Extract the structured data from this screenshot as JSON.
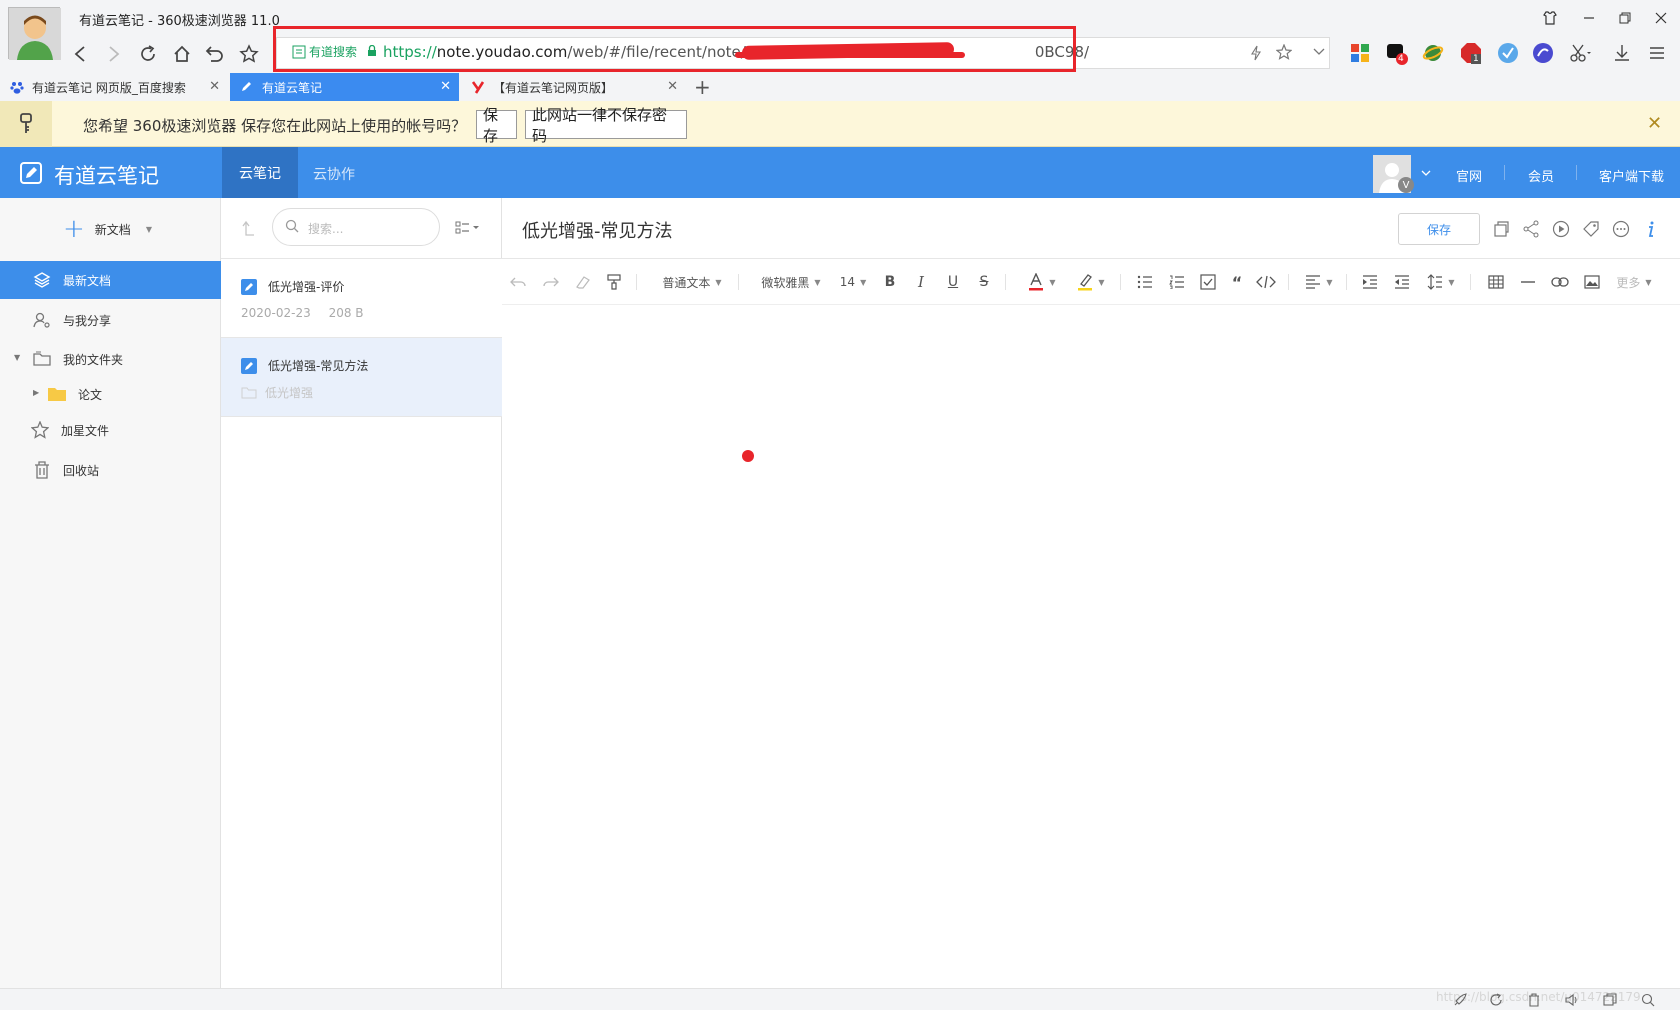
{
  "browser": {
    "window_title": "有道云笔记 - 360极速浏览器 11.0",
    "search_engine": "有道搜索",
    "url_proto": "https://",
    "url_host": "note.youdao.com",
    "url_path": "/web/#/file/recent/note/06CE",
    "url_tail": "0BC98/",
    "ext_badge_1": "4",
    "ext_badge_2": "1",
    "tabs": [
      {
        "label": "有道云笔记 网页版_百度搜索"
      },
      {
        "label": "有道云笔记"
      },
      {
        "label": "【有道云笔记网页版】"
      }
    ],
    "accent": "#3b8bf0",
    "highlight_color": "#e8252b"
  },
  "password_bar": {
    "text": "您希望 360极速浏览器 保存您在此网站上使用的帐号吗？",
    "save": "保存",
    "never": "此网站一律不保存密码"
  },
  "app": {
    "logo_text": "有道云笔记",
    "nav_notes": "云笔记",
    "nav_collab": "云协作",
    "links": [
      "官网",
      "会员",
      "客户端下载"
    ],
    "avatar_badge": "V",
    "brand_color": "#3d8eea"
  },
  "sidebar": {
    "new_doc": "新文档",
    "items": [
      {
        "label": "最新文档"
      },
      {
        "label": "与我分享"
      },
      {
        "label": "我的文件夹"
      },
      {
        "label": "论文"
      },
      {
        "label": "加星文件"
      },
      {
        "label": "回收站"
      }
    ]
  },
  "list": {
    "search_placeholder": "搜索...",
    "notes": [
      {
        "title": "低光增强-评价",
        "date": "2020-02-23",
        "size": "208 B"
      },
      {
        "title": "低光增强-常见方法",
        "folder": "低光增强"
      }
    ]
  },
  "editor": {
    "title": "低光增强-常见方法",
    "save": "保存",
    "block_format": "普通文本",
    "font": "微软雅黑",
    "font_size": "14",
    "more": "更多"
  },
  "status": {
    "watermark": "https://blog.csdn.net/u014722179"
  }
}
